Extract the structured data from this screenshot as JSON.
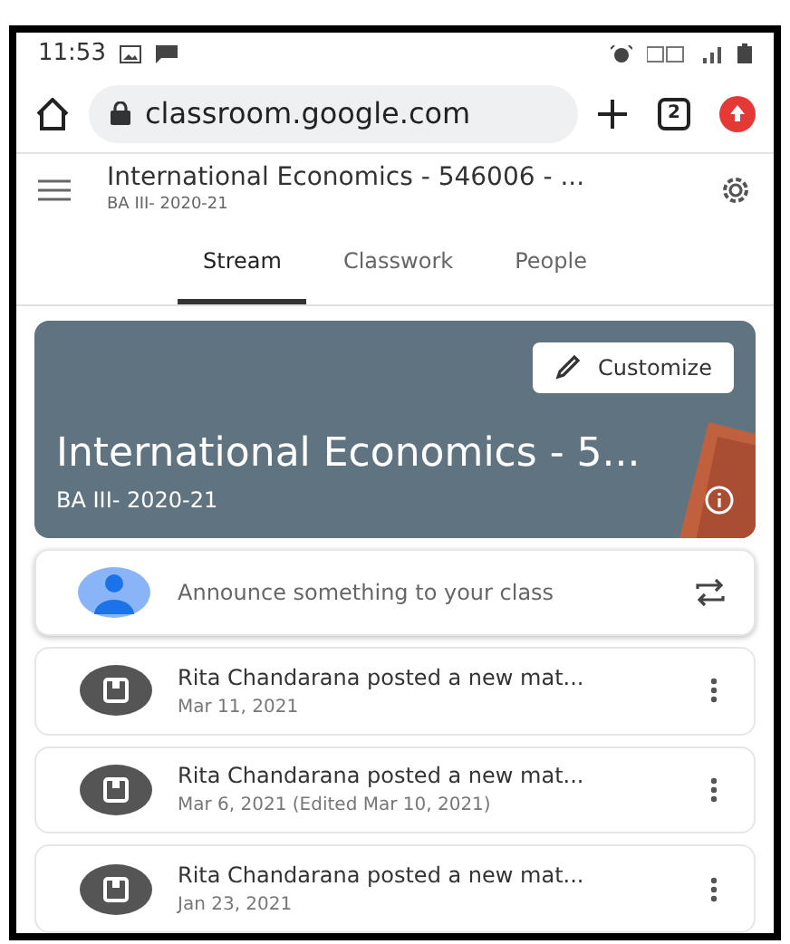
{
  "status_bar": {
    "time": "11:53"
  },
  "browser": {
    "url": "classroom.google.com",
    "tab_count": "2"
  },
  "header": {
    "title": "International Economics - 546006 - ...",
    "subtitle": "BA III- 2020-21"
  },
  "tabs": [
    {
      "label": "Stream",
      "selected": true
    },
    {
      "label": "Classwork",
      "selected": false
    },
    {
      "label": "People",
      "selected": false
    }
  ],
  "banner": {
    "button": "Customize",
    "title": "International Economics - 5...",
    "subtitle": "BA III- 2020-21"
  },
  "announce": {
    "placeholder": "Announce something to your class"
  },
  "posts": [
    {
      "title": "Rita Chandarana posted a new mat...",
      "date": "Mar 11, 2021"
    },
    {
      "title": "Rita Chandarana posted a new mat...",
      "date": "Mar 6, 2021 (Edited Mar 10, 2021)"
    },
    {
      "title": "Rita Chandarana posted a new mat...",
      "date": "Jan 23, 2021"
    }
  ]
}
